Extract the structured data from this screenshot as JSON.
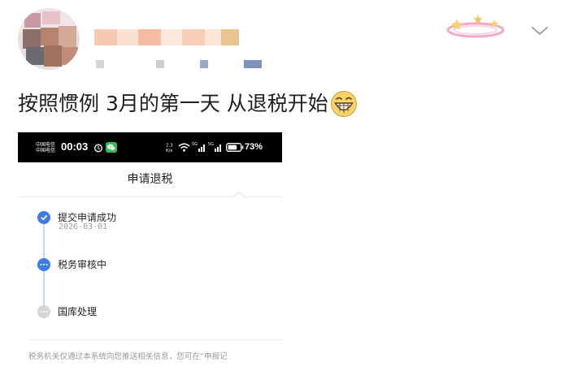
{
  "post": {
    "text": "按照惯例 3月的第一天 从退税开始"
  },
  "screenshot": {
    "status_bar": {
      "carrier_1": "中国电信",
      "carrier_2": "中国电信",
      "time": "00:03",
      "network_left": "2.3\nK/s",
      "battery": "73%"
    },
    "title": "申请退税",
    "steps": [
      {
        "title": "提交申请成功",
        "date": "2026-03-01",
        "state": "done"
      },
      {
        "title": "税务审核中",
        "state": "current"
      },
      {
        "title": "国库处理",
        "state": "pending"
      }
    ],
    "footnote": "税务机关仅通过本系统向您推送相关信息，您可在“申报记"
  },
  "colors": {
    "accent_blue": "#3f7be6",
    "pending_gray": "#d5d5d5",
    "timeline": "#c8d9f2"
  }
}
